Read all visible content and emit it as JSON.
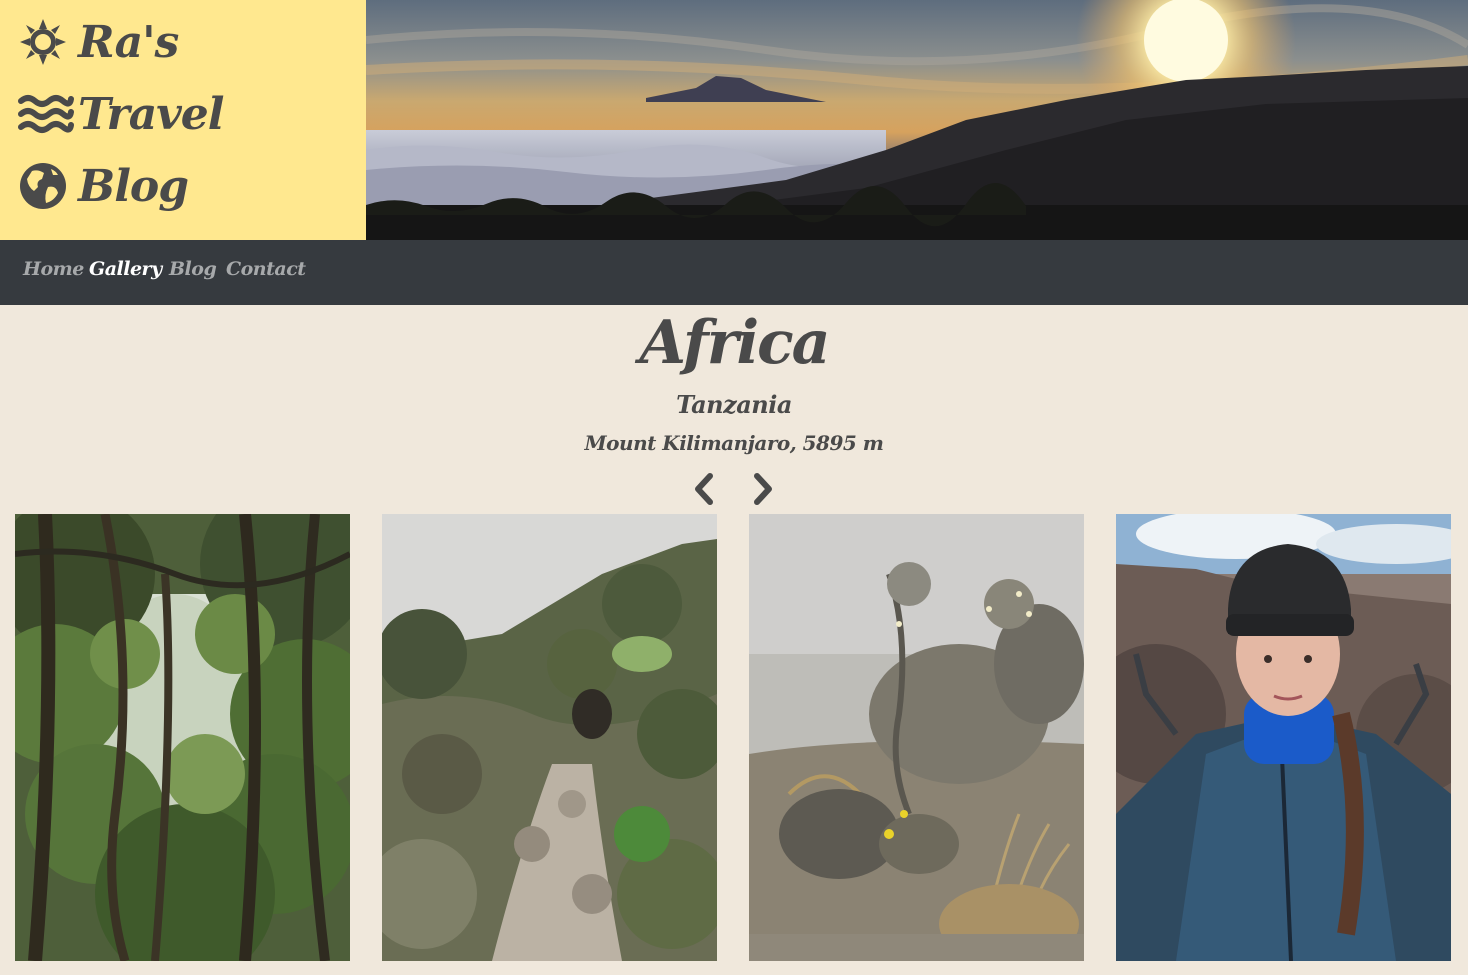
{
  "brand": {
    "line1": "Ra's",
    "line2": "Travel",
    "line3": "Blog",
    "icons": [
      "sun-icon",
      "waves-icon",
      "globe-icon"
    ]
  },
  "nav": {
    "items": [
      {
        "label": "Home",
        "active": false
      },
      {
        "label": "Gallery",
        "active": true
      },
      {
        "label": "Blog",
        "active": false
      },
      {
        "label": "Contact",
        "active": false
      }
    ]
  },
  "gallery": {
    "continent": "Africa",
    "country": "Tanzania",
    "location": "Mount Kilimanjaro, 5895 m",
    "prev_icon": "chevron-left-icon",
    "next_icon": "chevron-right-icon",
    "photos": [
      {
        "name": "rainforest-photo"
      },
      {
        "name": "rocky-trail-photo"
      },
      {
        "name": "misty-shrubs-photo"
      },
      {
        "name": "hiker-selfie-photo"
      }
    ]
  },
  "colors": {
    "brand_bg": "#ffe88f",
    "navbar_bg": "#363a3f",
    "page_bg": "#f0e8dc",
    "text": "#4a4a4a",
    "nav_inactive": "#a7a9ab",
    "nav_active": "#ffffff"
  }
}
